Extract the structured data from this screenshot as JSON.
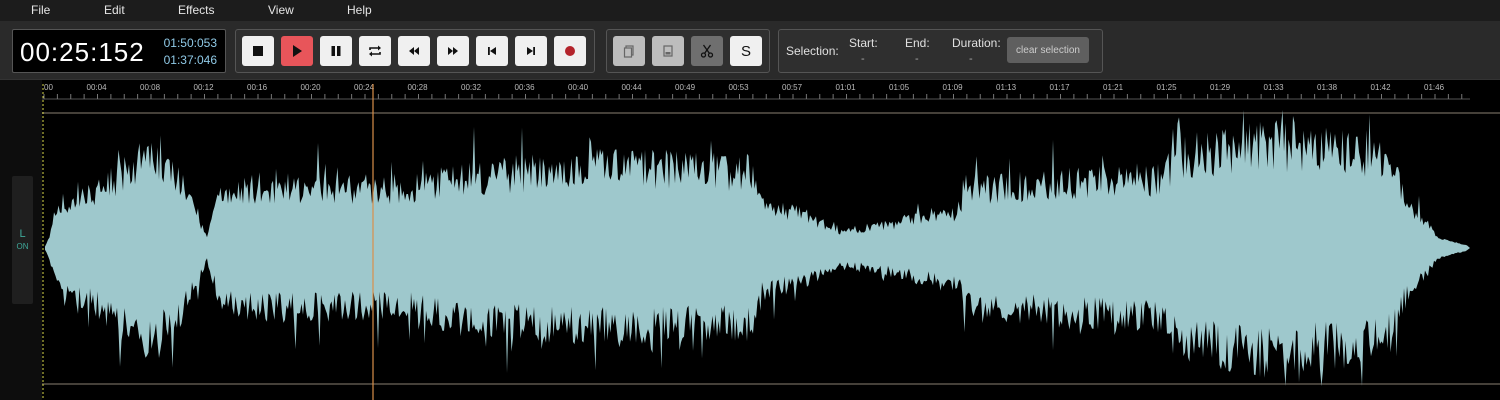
{
  "menu": {
    "items": [
      "File",
      "Edit",
      "Effects",
      "View",
      "Help"
    ]
  },
  "time": {
    "minutes": "00",
    "seconds": "25",
    "millis": "152",
    "total": "01:50:053",
    "remaining": "01:37:046"
  },
  "transport": {
    "buttons": [
      {
        "name": "stop-button",
        "icon": "stop-icon",
        "style": "normal"
      },
      {
        "name": "play-button",
        "icon": "play-icon",
        "style": "active"
      },
      {
        "name": "pause-button",
        "icon": "pause-icon",
        "style": "normal"
      },
      {
        "name": "loop-button",
        "icon": "loop-icon",
        "style": "normal"
      },
      {
        "name": "rewind-button",
        "icon": "rewind-icon",
        "style": "normal"
      },
      {
        "name": "fast-forward-button",
        "icon": "fast-forward-icon",
        "style": "normal"
      },
      {
        "name": "skip-to-start-button",
        "icon": "skip-start-icon",
        "style": "normal"
      },
      {
        "name": "skip-to-end-button",
        "icon": "skip-end-icon",
        "style": "normal"
      },
      {
        "name": "record-button",
        "icon": "record-icon",
        "style": "normal"
      }
    ]
  },
  "edit_tools": {
    "buttons": [
      {
        "name": "copy-button",
        "icon": "copy-icon",
        "style": "disabled"
      },
      {
        "name": "paste-button",
        "icon": "paste-icon",
        "style": "disabled"
      },
      {
        "name": "cut-button",
        "icon": "scissors-icon",
        "style": "dark"
      },
      {
        "name": "split-button",
        "icon": "split-icon",
        "label": "S",
        "style": "normal"
      }
    ]
  },
  "selection": {
    "label": "Selection:",
    "start_label": "Start:",
    "start_value": "-",
    "end_label": "End:",
    "end_value": "-",
    "duration_label": "Duration:",
    "duration_value": "-",
    "clear_label": "clear selection"
  },
  "channel": {
    "label": "L",
    "state": "ON"
  },
  "timeline": {
    "ticks": [
      "00",
      "00:04",
      "00:08",
      "00:12",
      "00:16",
      "00:20",
      "00:24",
      "00:28",
      "00:32",
      "00:36",
      "00:40",
      "00:44",
      "00:49",
      "00:53",
      "00:57",
      "01:01",
      "01:05",
      "01:09",
      "01:13",
      "01:17",
      "01:21",
      "01:25",
      "01:29",
      "01:33",
      "01:38",
      "01:42",
      "01:46"
    ]
  },
  "playhead": {
    "time": "00:25:152"
  },
  "colors": {
    "waveform": "#9ec8cc",
    "playhead": "#d9904a",
    "cursor": "#d8d84a",
    "play_active": "#e8555a",
    "time_sub": "#8fc9e6"
  }
}
